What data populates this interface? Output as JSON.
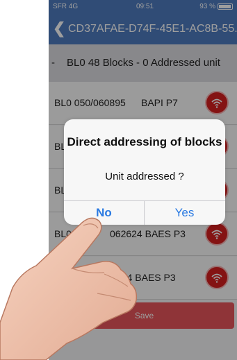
{
  "status_bar": {
    "carrier": "SFR 4G",
    "time": "09:51",
    "battery": "93 %"
  },
  "nav": {
    "title": "CD37AFAE-D74F-45E1-AC8B-55..."
  },
  "header": {
    "dash": "-",
    "text": "BL0 48 Blocks - 0 Addressed unit"
  },
  "rows": [
    {
      "label": "BL0  050/060895",
      "address": "BAPI P7"
    },
    {
      "label": "BL",
      "address": ""
    },
    {
      "label": "BL",
      "address": ""
    },
    {
      "label": "BL0  20",
      "address": "062624   BAES P3"
    },
    {
      "label": "",
      "address": "3/062624   BAES P3"
    }
  ],
  "save": {
    "label": "Save"
  },
  "dialog": {
    "title": "Direct addressing of blocks",
    "message": "Unit addressed ?",
    "no": "No",
    "yes": "Yes"
  },
  "colors": {
    "nav_blue": "#4e7bbe",
    "button_red": "#d62020",
    "save_red": "#e7545b",
    "alert_button_blue": "#2a7ae2"
  }
}
